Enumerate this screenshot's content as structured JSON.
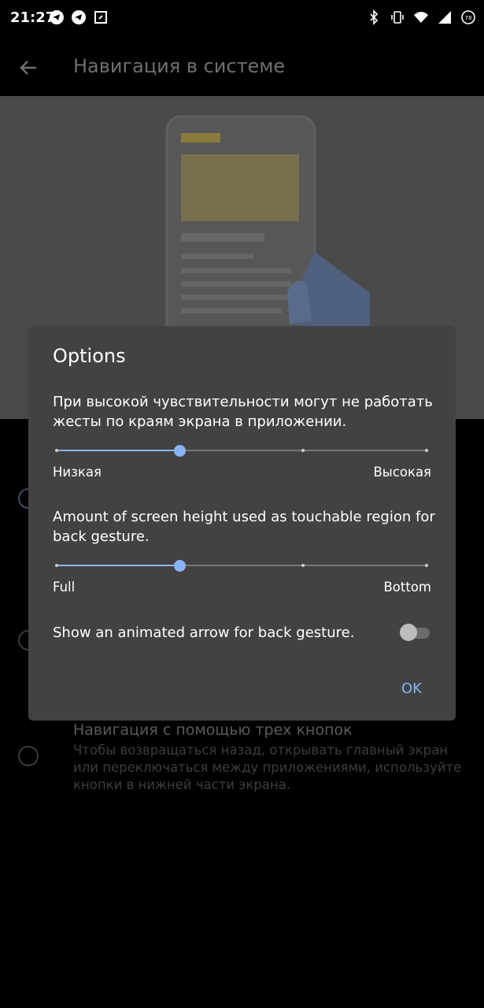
{
  "status_bar": {
    "time": "21:27",
    "left_icons": [
      "telegram-icon",
      "telegram-icon",
      "screenshot-icon"
    ],
    "right_icons": [
      "bluetooth-icon",
      "vibrate-icon",
      "wifi-icon",
      "signal-icon",
      "battery-icon"
    ],
    "battery_level": "78"
  },
  "app_bar": {
    "back_icon": "arrow-back-icon",
    "title": "Навигация в системе"
  },
  "background_options": {
    "three_button_title": "Навигация с помощью трех кнопок",
    "three_button_desc": "Чтобы возвращаться назад, открывать главный экран или переключаться между приложениями, используйте кнопки в нижней части экрана."
  },
  "dialog": {
    "title": "Options",
    "sensitivity_text": "При высокой чувствительности могут не работать жесты по краям экрана в приложении.",
    "sensitivity_slider": {
      "value": 1,
      "max": 3,
      "min_label": "Низкая",
      "max_label": "Высокая"
    },
    "height_text": "Amount of screen height used as touchable region for back gesture.",
    "height_slider": {
      "value": 1,
      "max": 3,
      "min_label": "Full",
      "max_label": "Bottom"
    },
    "arrow_toggle_label": "Show an animated arrow for back gesture.",
    "arrow_toggle_on": false,
    "ok_label": "OK"
  },
  "colors": {
    "accent": "#8ab4f8",
    "dialog_bg": "#424242",
    "illustration_bg": "#4a4a4a"
  }
}
